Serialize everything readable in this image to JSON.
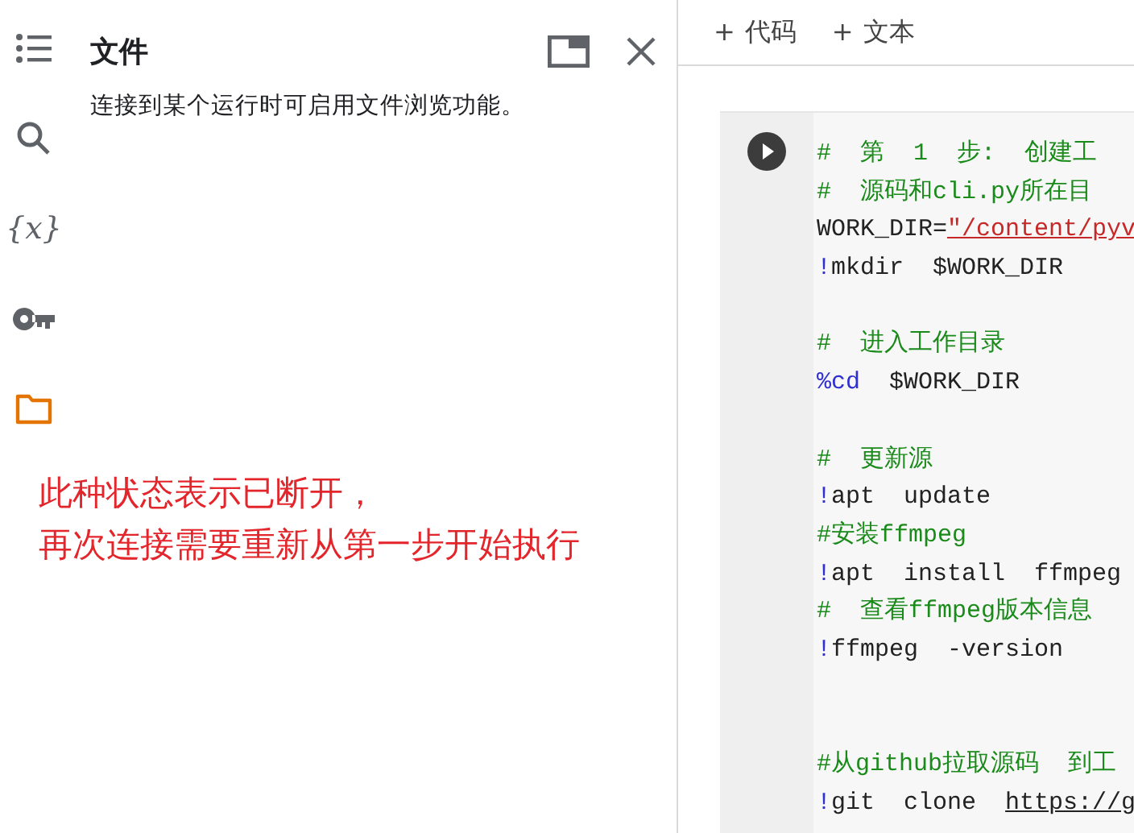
{
  "sidebar": {
    "items": [
      {
        "kind": "toc",
        "selected": false
      },
      {
        "kind": "search",
        "selected": false
      },
      {
        "kind": "variables",
        "text": "{x}",
        "selected": false
      },
      {
        "kind": "key",
        "selected": false
      },
      {
        "kind": "folder",
        "selected": true
      }
    ]
  },
  "panel": {
    "title": "文件",
    "message": "连接到某个运行时可启用文件浏览功能。"
  },
  "annotation": [
    "此种状态表示已断开，",
    "再次连接需要重新从第一步开始执行"
  ],
  "toolbar": {
    "buttons": [
      {
        "icon": "+",
        "label": "代码"
      },
      {
        "icon": "+",
        "label": "文本"
      }
    ]
  },
  "cell": {
    "lines": [
      [
        {
          "kind": "comment",
          "text": "#  第  1  步:  创建工"
        }
      ],
      [
        {
          "kind": "comment",
          "text": "#  源码和cli.py所在目"
        }
      ],
      [
        {
          "kind": "plain",
          "text": "WORK_DIR="
        },
        {
          "kind": "string",
          "text": "\"/content/pyv"
        }
      ],
      [
        {
          "kind": "magic",
          "text": "!"
        },
        {
          "kind": "plain",
          "text": "mkdir  $WORK_DIR"
        }
      ],
      [
        {
          "kind": "blank"
        }
      ],
      [
        {
          "kind": "comment",
          "text": "#  进入工作目录"
        }
      ],
      [
        {
          "kind": "magic",
          "text": "%cd"
        },
        {
          "kind": "plain",
          "text": "  $WORK_DIR"
        }
      ],
      [
        {
          "kind": "blank"
        }
      ],
      [
        {
          "kind": "comment",
          "text": "#  更新源"
        }
      ],
      [
        {
          "kind": "magic",
          "text": "!"
        },
        {
          "kind": "plain",
          "text": "apt  update"
        }
      ],
      [
        {
          "kind": "comment",
          "text": "#安装ffmpeg"
        }
      ],
      [
        {
          "kind": "magic",
          "text": "!"
        },
        {
          "kind": "plain",
          "text": "apt  install  ffmpeg"
        }
      ],
      [
        {
          "kind": "comment",
          "text": "#  查看ffmpeg版本信息"
        }
      ],
      [
        {
          "kind": "magic",
          "text": "!"
        },
        {
          "kind": "plain",
          "text": "ffmpeg  -version"
        }
      ],
      [
        {
          "kind": "blank"
        }
      ],
      [
        {
          "kind": "blank"
        }
      ],
      [
        {
          "kind": "comment",
          "text": "#从github拉取源码  到工"
        }
      ],
      [
        {
          "kind": "magic",
          "text": "!"
        },
        {
          "kind": "plain",
          "text": "git  clone  "
        },
        {
          "kind": "link",
          "text": "https://g"
        }
      ]
    ]
  }
}
